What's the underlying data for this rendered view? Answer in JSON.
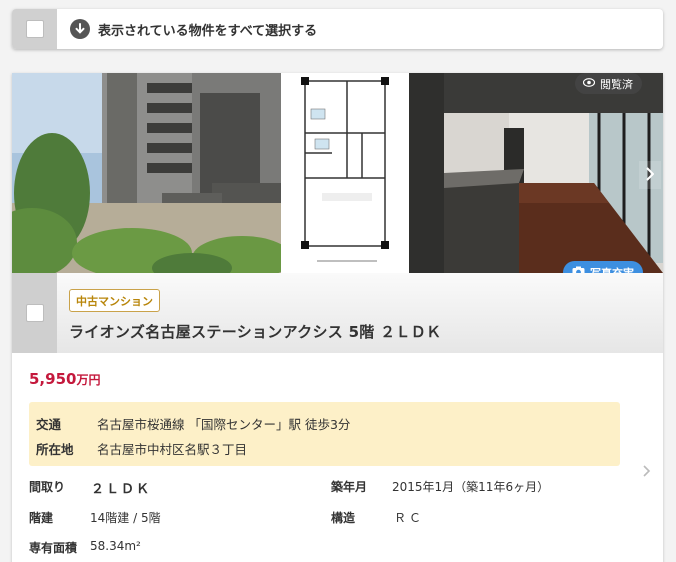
{
  "select_all": {
    "label": "表示されている物件をすべて選択する",
    "checked": false
  },
  "photos": {
    "viewed_badge": "閲覧済",
    "photo_badge": "写真充実",
    "items": [
      "exterior-photo",
      "floor-plan",
      "interior-photo"
    ]
  },
  "property": {
    "type": "中古マンション",
    "name": "ライオンズ名古屋ステーションアクシス 5階 ２ＬＤＫ",
    "price_value": "5,950",
    "price_unit": "万円",
    "access_label": "交通",
    "access_value": "名古屋市桜通線 「国際センター」駅 徒歩3分",
    "address_label": "所在地",
    "address_value": "名古屋市中村区名駅３丁目",
    "specs": {
      "layout_label": "間取り",
      "layout_value": "２ＬＤＫ",
      "built_label": "築年月",
      "built_value": "2015年1月（築11年6ヶ月）",
      "floors_label": "階建",
      "floors_value": "14階建 / 5階",
      "structure_label": "構造",
      "structure_value": "ＲＣ",
      "area_label": "専有面積",
      "area_value": "58.34m²"
    }
  },
  "colors": {
    "price": "#c4183c",
    "badge_border": "#c9a24a",
    "photo_badge": "#3d8fe0",
    "access_bg": "#fdf0c8"
  }
}
